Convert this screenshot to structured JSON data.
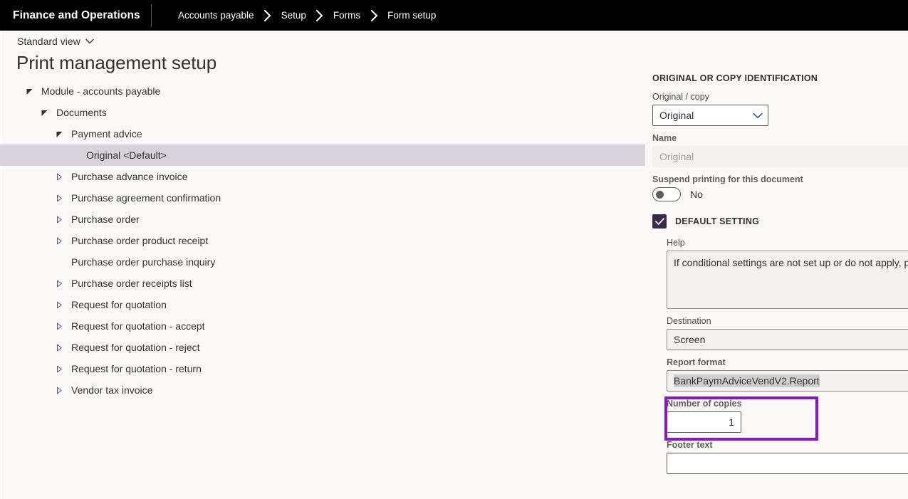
{
  "topbar": {
    "brand": "Finance and Operations",
    "breadcrumb": [
      {
        "label": "Accounts payable"
      },
      {
        "label": "Setup"
      },
      {
        "label": "Forms"
      },
      {
        "label": "Form setup"
      }
    ],
    "separator_icon": "chevron-right-icon"
  },
  "page": {
    "view_selector": "Standard view",
    "view_selector_icon": "chevron-down-icon",
    "title": "Print management setup"
  },
  "tree": [
    {
      "label": "Module - accounts payable",
      "indent": 0,
      "twisty": "expanded",
      "selected": false
    },
    {
      "label": "Documents",
      "indent": 1,
      "twisty": "expanded",
      "selected": false
    },
    {
      "label": "Payment advice",
      "indent": 2,
      "twisty": "expanded",
      "selected": false
    },
    {
      "label": "Original <Default>",
      "indent": 3,
      "twisty": "none",
      "selected": true
    },
    {
      "label": "Purchase advance invoice",
      "indent": 2,
      "twisty": "collapsed",
      "selected": false
    },
    {
      "label": "Purchase agreement confirmation",
      "indent": 2,
      "twisty": "collapsed",
      "selected": false
    },
    {
      "label": "Purchase order",
      "indent": 2,
      "twisty": "collapsed",
      "selected": false
    },
    {
      "label": "Purchase order product receipt",
      "indent": 2,
      "twisty": "collapsed",
      "selected": false
    },
    {
      "label": "Purchase order purchase inquiry",
      "indent": 2,
      "twisty": "none",
      "selected": false
    },
    {
      "label": "Purchase order receipts list",
      "indent": 2,
      "twisty": "collapsed",
      "selected": false
    },
    {
      "label": "Request for quotation",
      "indent": 2,
      "twisty": "collapsed",
      "selected": false
    },
    {
      "label": "Request for quotation - accept",
      "indent": 2,
      "twisty": "collapsed",
      "selected": false
    },
    {
      "label": "Request for quotation - reject",
      "indent": 2,
      "twisty": "collapsed",
      "selected": false
    },
    {
      "label": "Request for quotation - return",
      "indent": 2,
      "twisty": "collapsed",
      "selected": false
    },
    {
      "label": "Vendor tax invoice",
      "indent": 2,
      "twisty": "collapsed",
      "selected": false
    }
  ],
  "identification": {
    "heading": "Original or copy identification",
    "original_copy_label": "Original / copy",
    "original_copy_value": "Original",
    "original_copy_icon": "chevron-down-icon",
    "name_label": "Name",
    "name_value": "Original",
    "suspend_label": "Suspend printing for this document",
    "suspend_value": "No"
  },
  "default_setting": {
    "heading": "Default setting",
    "checkbox_icon": "checkmark-icon",
    "checked": true,
    "help_label": "Help",
    "help_value": "If conditional settings are not set up or do not apply, p",
    "destination_label": "Destination",
    "destination_value": "Screen",
    "report_format_label": "Report format",
    "report_format_value": "BankPaymAdviceVendV2.Report",
    "copies_label": "Number of copies",
    "copies_value": "1",
    "footer_label": "Footer text",
    "footer_value": ""
  },
  "annotation": {
    "color": "#8a16c4",
    "target": "report-format-field"
  }
}
